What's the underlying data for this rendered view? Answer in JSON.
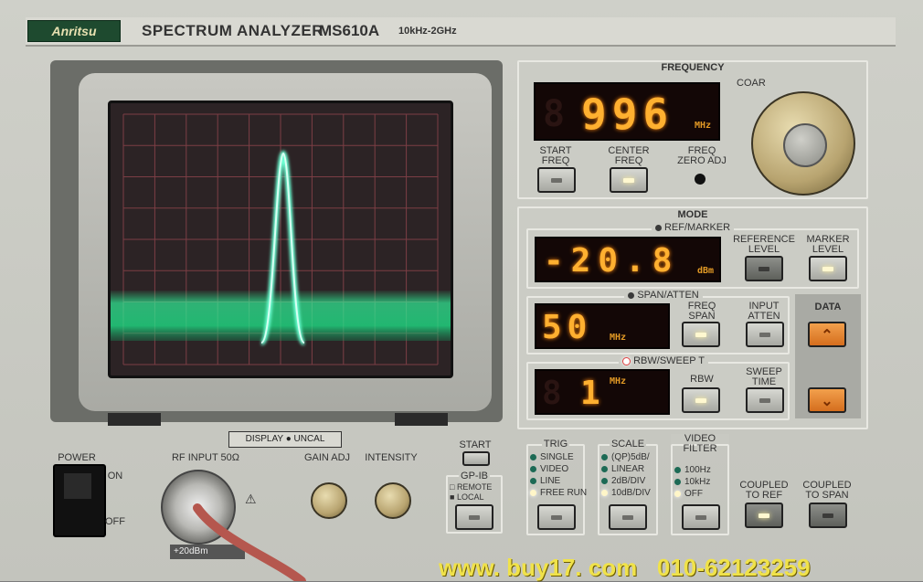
{
  "brand": "Anritsu",
  "title": "SPECTRUM ANALYZER",
  "model": "MS610A",
  "range": "10kHz-2GHz",
  "frequency": {
    "section": "FREQUENCY",
    "value": "996",
    "unit": "MHz",
    "coarse": "COAR",
    "start_freq": [
      "START",
      "FREQ"
    ],
    "center_freq": [
      "CENTER",
      "FREQ"
    ],
    "freq_zero_adj": [
      "FREQ",
      "ZERO ADJ"
    ]
  },
  "mode": {
    "section": "MODE",
    "ref_marker": "REF/MARKER",
    "ref_value": "-20.8",
    "ref_unit": "dBm",
    "reference_level": [
      "REFERENCE",
      "LEVEL"
    ],
    "marker_level": [
      "MARKER",
      "LEVEL"
    ],
    "span_atten": "SPAN/ATTEN",
    "span_value": "50",
    "span_unit": "MHz",
    "freq_span": [
      "FREQ",
      "SPAN"
    ],
    "input_atten": [
      "INPUT",
      "ATTEN"
    ],
    "rbw_sweep": "RBW/SWEEP T",
    "rbw_value": "1",
    "rbw_unit": "MHz",
    "rbw": "RBW",
    "sweep_time": [
      "SWEEP",
      "TIME"
    ],
    "data": "DATA"
  },
  "display_uncal": "DISPLAY ● UNCAL",
  "power": {
    "label": "POWER",
    "on": "ON",
    "off": "OFF"
  },
  "rf_input": "RF INPUT 50Ω",
  "rf_input_plate": "+20dBm",
  "gain_adj": "GAIN ADJ",
  "intensity": "INTENSITY",
  "start_btn": "START",
  "gpib": {
    "label": "GP-IB",
    "remote": "REMOTE",
    "local": "LOCAL"
  },
  "trig": {
    "label": "TRIG",
    "options": [
      "SINGLE",
      "VIDEO",
      "LINE",
      "FREE RUN"
    ]
  },
  "scale": {
    "label": "SCALE",
    "options": [
      "(QP)5dB/",
      "LINEAR",
      "2dB/DIV",
      "10dB/DIV"
    ]
  },
  "video_filter": {
    "label": [
      "VIDEO",
      "FILTER"
    ],
    "options": [
      "100Hz",
      "10kHz",
      "OFF"
    ]
  },
  "coupled_ref": [
    "COUPLED",
    "TO REF"
  ],
  "coupled_span": [
    "COUPLED",
    "TO SPAN"
  ],
  "watermark": "www. buy17. com   010-62123259",
  "colors": {
    "trace": "#5dffc8",
    "led_display": "#ffb030",
    "panel": "#c8c9c2"
  }
}
